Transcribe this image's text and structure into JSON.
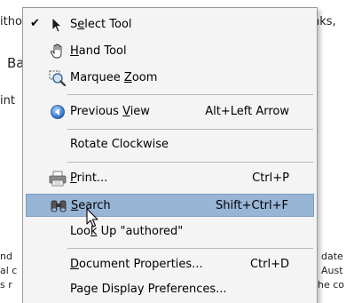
{
  "background_text": {
    "left_top": "itho",
    "right_top": "nks,",
    "left_ba": "Ba",
    "left_int": "int",
    "left_nd": "nd",
    "left_al": "al c",
    "left_s": "s r",
    "right_date": "date",
    "right_aust": "Aust",
    "right_co": "he co"
  },
  "menu": {
    "items": [
      {
        "id": "select-tool",
        "label_pre": "S",
        "label_ul": "e",
        "label_post": "lect Tool",
        "accel": "",
        "checked": true,
        "icon": "arrow-cursor-icon"
      },
      {
        "id": "hand-tool",
        "label_pre": "",
        "label_ul": "H",
        "label_post": "and Tool",
        "accel": "",
        "checked": false,
        "icon": "hand-icon"
      },
      {
        "id": "marquee-zoom",
        "label_pre": "Marquee ",
        "label_ul": "Z",
        "label_post": "oom",
        "accel": "",
        "checked": false,
        "icon": "marquee-zoom-icon"
      },
      {
        "id": "previous-view",
        "label_pre": "Previous ",
        "label_ul": "V",
        "label_post": "iew",
        "accel": "Alt+Left Arrow",
        "checked": false,
        "icon": "previous-view-icon"
      },
      {
        "id": "rotate-clockwise",
        "label_pre": "Rotate Clockwise",
        "label_ul": "",
        "label_post": "",
        "accel": "",
        "checked": false,
        "icon": ""
      },
      {
        "id": "print",
        "label_pre": "",
        "label_ul": "P",
        "label_post": "rint...",
        "accel": "Ctrl+P",
        "checked": false,
        "icon": "printer-icon"
      },
      {
        "id": "search",
        "label_pre": "",
        "label_ul": "S",
        "label_post": "earch",
        "accel": "Shift+Ctrl+F",
        "checked": false,
        "icon": "binoculars-icon",
        "selected": true
      },
      {
        "id": "look-up",
        "label_pre": "Loo",
        "label_ul": "k",
        "label_post": " Up \"authored\"",
        "accel": "",
        "checked": false,
        "icon": ""
      },
      {
        "id": "document-properties",
        "label_pre": "",
        "label_ul": "D",
        "label_post": "ocument Properties...",
        "accel": "Ctrl+D",
        "checked": false,
        "icon": ""
      },
      {
        "id": "page-display-preferences",
        "label_pre": "Page Display Preferences...",
        "label_ul": "",
        "label_post": "",
        "accel": "",
        "checked": false,
        "icon": ""
      }
    ],
    "check_glyph": "✔"
  },
  "colors": {
    "menu_bg": "#f4f4f4",
    "selected_bg": "#98b5d6",
    "separator": "#b9b9b9"
  }
}
